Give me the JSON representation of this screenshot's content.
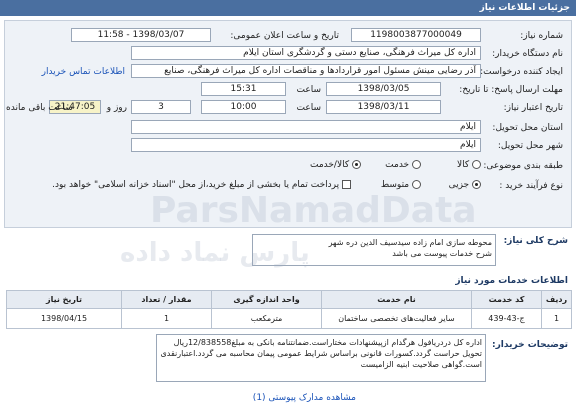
{
  "header": {
    "title": "جزئیات اطلاعات نیاز"
  },
  "form": {
    "need_number_label": "شماره نیاز:",
    "need_number": "1198003877000049",
    "announce_label": "تاریخ و ساعت اعلان عمومی:",
    "announce_value": "1398/03/07 - 11:58",
    "buyer_label": "نام دستگاه خریدار:",
    "buyer_value": "اداره کل میراث فرهنگی، صنایع دستی و گردشگری استان ایلام",
    "creator_label": "ایجاد کننده درخواست:",
    "creator_value": "آذر رضایی مینش مسئول امور قراردادها و مناقصات اداره کل میراث فرهنگی، صنایع",
    "contact_link": "اطلاعات تماس خریدار",
    "reply_deadline_label": "مهلت ارسال پاسخ: تا تاریخ:",
    "reply_date": "1398/03/05",
    "time_label": "ساعت",
    "reply_time": "15:31",
    "validity_label": "تاریخ اعتبار نیاز:",
    "validity_date": "1398/03/11",
    "validity_time": "10:00",
    "days_label": "روز و",
    "days_value": "3",
    "remaining_time": "21:47:05",
    "remaining_label": "ساعت باقی مانده",
    "province_label": "استان محل تحویل:",
    "province_value": "ایلام",
    "city_label": "شهر محل تحویل:",
    "city_value": "ایلام",
    "category_label": "طبقه بندی موضوعی:",
    "category_options": [
      "کالا",
      "خدمت",
      "کالا/خدمت"
    ],
    "category_selected": "کالا/خدمت",
    "purchase_label": "نوع فرآیند خرید :",
    "purchase_options": [
      "جزیی",
      "متوسط"
    ],
    "purchase_selected": "جزیی",
    "purchase_note": "پرداخت تمام یا بخشی از مبلغ خرید،از محل \"اسناد خزانه اسلامی\" خواهد بود."
  },
  "general": {
    "title": "شرح کلی نیاز:",
    "text_line1": "محوطه سازی امام زاده سیدسیف الدین دره شهر",
    "text_line2": "شرح خدمات پیوست می باشد"
  },
  "services": {
    "title": "اطلاعات خدمات مورد نیاز",
    "columns": [
      "ردیف",
      "کد خدمت",
      "نام خدمت",
      "واحد اندازه گیری",
      "مقدار / تعداد",
      "تاریخ نیاز"
    ],
    "rows": [
      [
        "1",
        "ج-43-439",
        "سایر فعالیت‌های تخصصی ساختمان",
        "مترمکعب",
        "1",
        "1398/04/15"
      ]
    ]
  },
  "buyer_notes": {
    "title": "توضیحات خریدار:",
    "text": "اداره کل دردریافول هرگدام ازپیشنهادات مختاراست.ضمانتنامه بانکی به مبلغ12/838558ریال تحویل حراست گردد.کسورات قانونی براساس شرایط عمومی پیمان محاسبه می گردد.اعتبارنقدی است.گواهی صلاحیت ابنیه الزامیست"
  },
  "footer": {
    "attachments_label": "مشاهده مدارک پیوستی (1)"
  },
  "watermark": {
    "line1": "ParsNamadData",
    "line2": "پارس نماد داده"
  }
}
